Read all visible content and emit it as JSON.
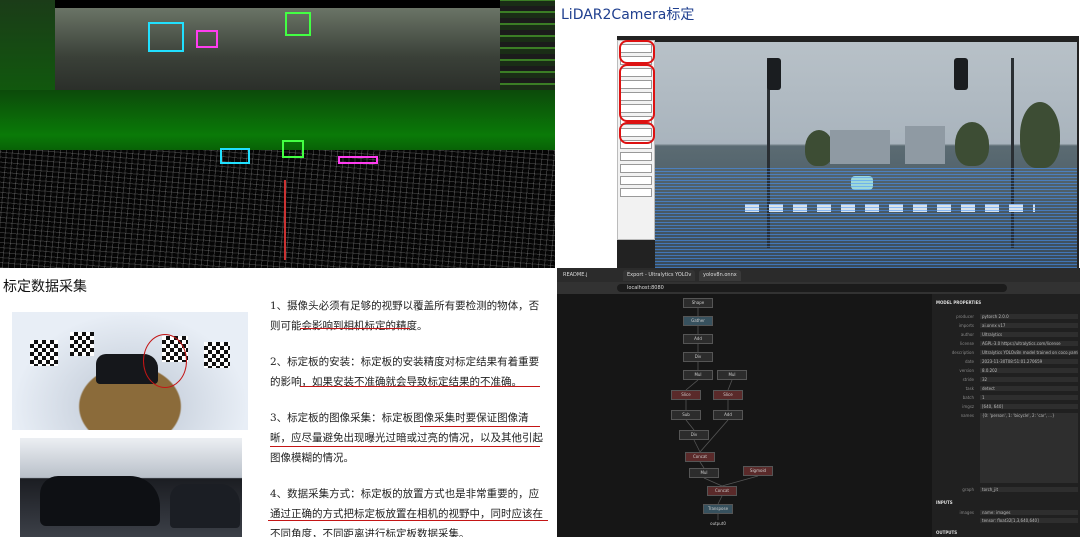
{
  "panel_lidar": {
    "caption": ""
  },
  "panel_calib": {
    "title": "LiDAR2Camera标定"
  },
  "panel_doc": {
    "title": "标定数据采集",
    "paragraphs": [
      "1、摄像头必须有足够的视野以覆盖所有要检测的物体，否则可能会影响到相机标定的精度。",
      "2、标定板的安装：标定板的安装精度对标定结果有着重要的影响，如果安装不准确就会导致标定结果的不准确。",
      "3、标定板的图像采集：标定板图像采集时要保证图像清晰，应尽量避免出现曝光过暗或过亮的情况，以及其他引起图像模糊的情况。",
      "4、数据采集方式：标定板的放置方式也是非常重要的，应通过正确的方式把标定板放置在相机的视野中，同时应该在不同角度，不同距离进行标定板数据采集。"
    ]
  },
  "panel_netron": {
    "tabs": [
      "README.j",
      "Export - Ultralytics YOLOv",
      "yolov8n.onnx"
    ],
    "address": "localhost:8080",
    "section_model": "MODEL PROPERTIES",
    "props": [
      {
        "k": "producer",
        "v": "pytorch 2.0.0"
      },
      {
        "k": "imports",
        "v": "ai.onnx v17"
      },
      {
        "k": "author",
        "v": "Ultralytics"
      },
      {
        "k": "license",
        "v": "AGPL-3.0 https://ultralytics.com/license"
      },
      {
        "k": "description",
        "v": "Ultralytics YOLOv8n model trained on coco.yaml"
      },
      {
        "k": "date",
        "v": "2023-11-30T08:51:01.270659"
      },
      {
        "k": "version",
        "v": "8.0.202"
      },
      {
        "k": "stride",
        "v": "32"
      },
      {
        "k": "task",
        "v": "detect"
      },
      {
        "k": "batch",
        "v": "1"
      },
      {
        "k": "imgsz",
        "v": "[640, 640]"
      },
      {
        "k": "names",
        "v": "{0: 'person', 1: 'bicycle', 2: 'car', ...}"
      },
      {
        "k": "graph",
        "v": "torch_jit"
      }
    ],
    "section_inputs": "INPUTS",
    "input_name": "images",
    "input_type": "name: images",
    "input_shape": "tensor: float32[1,3,640,640]",
    "section_outputs": "OUTPUTS",
    "graph_nodes": [
      "Shape",
      "Gather",
      "Add",
      "Div",
      "Mul",
      "Slice",
      "Sub",
      "Concat",
      "Sigmoid",
      "Transpose",
      "output0"
    ]
  }
}
